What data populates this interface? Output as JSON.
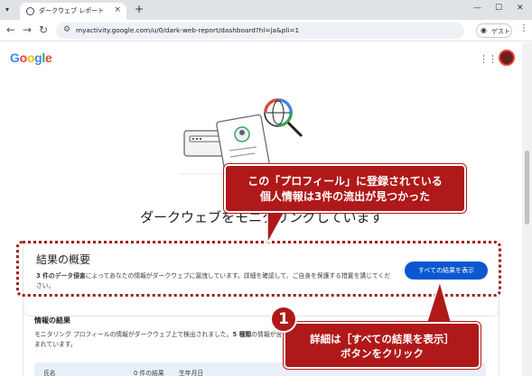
{
  "browser": {
    "tab_title": "ダークウェブ レポート",
    "tab_close": "×",
    "new_tab": "+",
    "url": "myactivity.google.com/u/0/dark-web-report/dashboard?hl=ja&pli=1",
    "guest_label": "ゲスト",
    "back": "←",
    "forward": "→",
    "reload": "↻",
    "minimize": "—",
    "maximize": "☐",
    "close": "✕",
    "menu": "⋮"
  },
  "page": {
    "logo": "Google",
    "heading": "ダークウェブをモニタリングしています",
    "summary": {
      "title": "結果の概要",
      "desc_bold": "3 件のデータ侵害",
      "desc_rest": "によってあなたの情報がダークウェブに漏洩しています。詳細を確認して、ご自身を保護する措置を講じてください。",
      "button": "すべての結果を表示"
    },
    "info": {
      "title": "情報の結果",
      "desc_start": "モニタリング プロフィールの情報がダークウェブ上で検出されました。",
      "desc_bold": "5 種類",
      "desc_end": "の情報が含まれています。",
      "col_type": "氏名",
      "col_count": "0 件の結果",
      "col_birth": "生年月日"
    }
  },
  "annotations": {
    "callout1_line1": "この「プロフィール」に登録されている",
    "callout1_line2": "個人情報は3件の流出が見つかった",
    "badge": "1",
    "callout2_line1": "詳細は［すべての結果を表示］",
    "callout2_line2": "ボタンをクリック",
    "color": "#b01919"
  },
  "colors": {
    "accent": "#0b57d0",
    "annotation": "#b01919"
  }
}
